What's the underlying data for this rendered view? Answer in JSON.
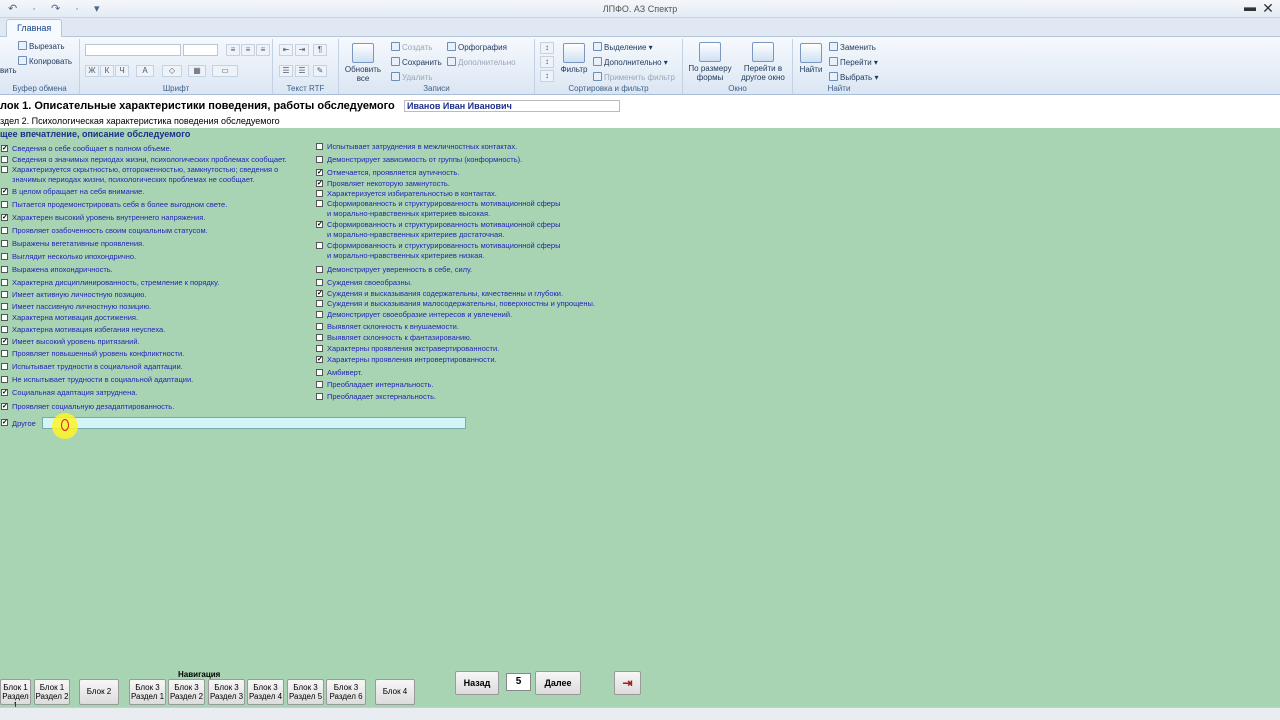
{
  "window": {
    "title": "ЛПФО. АЗ Спектр",
    "qat": "↶ · ↷ · ▾",
    "close": "✕",
    "minimize": "▬"
  },
  "ribbon": {
    "tab": "Главная",
    "groups": {
      "clipboard": {
        "label": "Буфер обмена",
        "paste": "вить",
        "cut": "Вырезать",
        "copy": "Копировать"
      },
      "font": {
        "label": "Шрифт",
        "bold": "Ж",
        "italic": "К",
        "underline": "Ч",
        "color": "A"
      },
      "rtf": {
        "label": "Текст RTF"
      },
      "records": {
        "label": "Записи",
        "refresh": "Обновить все",
        "create": "Создать",
        "save": "Сохранить",
        "delete": "Удалить",
        "spelling": "Орфография",
        "more": "Дополнительно"
      },
      "sort": {
        "label": "Сортировка и фильтр",
        "filter": "Фильтр",
        "selection": "Выделение",
        "advanced": "Дополнительно",
        "apply": "Применить фильтр"
      },
      "window": {
        "label": "Окно",
        "fit": "По размеру формы",
        "switch": "Перейти в другое окно"
      },
      "find": {
        "label": "Найти",
        "find": "Найти",
        "replace": "Заменить",
        "goto": "Перейти",
        "select": "Выбрать"
      }
    }
  },
  "form": {
    "block_title": "лок 1. Описательные характеристики поведения, работы обследуемого",
    "person": "Иванов Иван Иванович",
    "section_title": "здел 2. Психологическая характеристика поведения обследуемого",
    "group_title": "щее впечатление, описание обследуемого",
    "left_items": [
      {
        "text": "Сведения о себе сообщает в полном объеме.",
        "checked": true
      },
      {
        "text": "Сведения о значимых периодах жизни, психологических проблемах сообщает.",
        "checked": false
      },
      {
        "text": "Характеризуется скрытностью, отгороженностью, замкнутостью; сведения о",
        "text2": "значимых периодах жизни, психологических проблемах не сообщает.",
        "checked": false
      },
      {
        "text": "В целом обращает на себя внимание.",
        "checked": true
      },
      {
        "text": "Пытается продемонстрировать себя в более выгодном свете.",
        "checked": false
      },
      {
        "text": "Характерен высокий уровень внутреннего напряжения.",
        "checked": true
      },
      {
        "text": "Проявляет озабоченность своим социальным статусом.",
        "checked": false
      },
      {
        "text": "Выражены вегетативные проявления.",
        "checked": false
      },
      {
        "text": "Выглядит несколько ипохондрично.",
        "checked": false
      },
      {
        "text": "Выражена ипохондричность.",
        "checked": false
      },
      {
        "text": "Характерна дисциплинированность, стремление к порядку.",
        "checked": false
      },
      {
        "text": "Имеет активную личностную позицию.",
        "checked": false
      },
      {
        "text": "Имеет пассивную личностную позицию.",
        "checked": false
      },
      {
        "text": "Характерна мотивация достижения.",
        "checked": false
      },
      {
        "text": "Характерна мотивация избегания неуспеха.",
        "checked": false
      },
      {
        "text": "Имеет высокий уровень притязаний.",
        "checked": true
      },
      {
        "text": "Проявляет повышенный уровень конфликтности.",
        "checked": false
      },
      {
        "text": "Испытывает трудности в социальной адаптации.",
        "checked": false
      },
      {
        "text": "Не испытывает трудности в социальной адаптации.",
        "checked": false
      },
      {
        "text": "Социальная адаптация затруднена.",
        "checked": true
      },
      {
        "text": "Проявляет социальную дезадаптированность.",
        "checked": true
      }
    ],
    "right_items": [
      {
        "text": "Испытывает затруднения  в межличностных контактах.",
        "checked": false
      },
      {
        "text": "Демонстрирует зависимость от группы (конформность).",
        "checked": false
      },
      {
        "text": "Отмечается, проявляется аутичность.",
        "checked": true
      },
      {
        "text": "Проявляет некоторую замкнутость.",
        "checked": true
      },
      {
        "text": "Характеризуется избирательностью в контактах.",
        "checked": false
      },
      {
        "text": "Сформированность и структурированность мотивационной сферы",
        "text2": "и морально-нравственных критериев высокая.",
        "checked": false
      },
      {
        "text": "Сформированность и структурированность мотивационной сферы",
        "text2": "и морально-нравственных критериев достаточная.",
        "checked": true
      },
      {
        "text": "Сформированность и структурированность мотивационной сферы",
        "text2": "и морально-нравственных критериев низкая.",
        "checked": false
      },
      {
        "text": "Демонстрирует уверенность в себе, силу.",
        "checked": false
      },
      {
        "text": "Суждения своеобразны.",
        "checked": false
      },
      {
        "text": "Суждения и высказывания содержательны, качественны и глубоки.",
        "checked": true
      },
      {
        "text": "Суждения и высказывания малосодержательны, поверхностны и упрощены.",
        "checked": false
      },
      {
        "text": "Демонстрирует своеобразие интересов и увлечений.",
        "checked": false
      },
      {
        "text": "Выявляет склонность к внушаемости.",
        "checked": false
      },
      {
        "text": "Выявляет склонность к фантазированию.",
        "checked": false
      },
      {
        "text": "Характерны проявления экстравертированности.",
        "checked": false
      },
      {
        "text": "Характерны проявления интровертированности.",
        "checked": true
      },
      {
        "text": "Амбиверт.",
        "checked": false
      },
      {
        "text": "Преобладает интернальность.",
        "checked": false
      },
      {
        "text": "Преобладает экстернальность.",
        "checked": false
      }
    ],
    "other": {
      "label": "Другое",
      "checked": true,
      "value": ""
    }
  },
  "footer": {
    "nav_title": "Навигация",
    "nav_buttons": [
      {
        "l1": "Блок 1",
        "l2": "Раздел 1"
      },
      {
        "l1": "Блок 1",
        "l2": "Раздел 2"
      },
      {
        "l1": "Блок 2",
        "l2": ""
      },
      {
        "l1": "Блок 3",
        "l2": "Раздел 1"
      },
      {
        "l1": "Блок 3",
        "l2": "Раздел 2"
      },
      {
        "l1": "Блок 3",
        "l2": "Раздел 3"
      },
      {
        "l1": "Блок 3",
        "l2": "Раздел 4"
      },
      {
        "l1": "Блок 3",
        "l2": "Раздел 5"
      },
      {
        "l1": "Блок 3",
        "l2": "Раздел 6"
      },
      {
        "l1": "Блок 4",
        "l2": ""
      }
    ],
    "back": "Назад",
    "page": "5",
    "next": "Далее",
    "exit_icon": "⇥"
  }
}
